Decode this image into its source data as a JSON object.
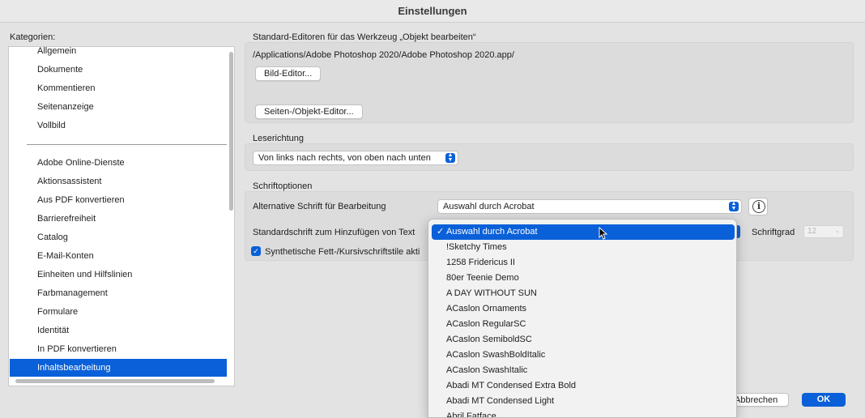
{
  "window": {
    "title": "Einstellungen"
  },
  "categories": {
    "label": "Kategorien:",
    "group1": [
      "Allgemein",
      "Dokumente",
      "Kommentieren",
      "Seitenanzeige",
      "Vollbild"
    ],
    "group2": [
      "Adobe Online-Dienste",
      "Aktionsassistent",
      "Aus PDF konvertieren",
      "Barrierefreiheit",
      "Catalog",
      "E-Mail-Konten",
      "Einheiten und Hilfslinien",
      "Farbmanagement",
      "Formulare",
      "Identität",
      "In PDF konvertieren",
      "Inhaltsbearbeitung"
    ],
    "selected": "Inhaltsbearbeitung"
  },
  "editors": {
    "label": "Standard-Editoren für das Werkzeug „Objekt bearbeiten“",
    "path": "/Applications/Adobe Photoshop 2020/Adobe Photoshop 2020.app/",
    "image_editor_button": "Bild-Editor...",
    "page_editor_button": "Seiten-/Objekt-Editor..."
  },
  "reading": {
    "label": "Leserichtung",
    "value": "Von links nach rechts, von oben nach unten"
  },
  "fonts": {
    "label": "Schriftoptionen",
    "alt_font_label": "Alternative Schrift für Bearbeitung",
    "alt_font_value": "Auswahl durch Acrobat",
    "default_font_label": "Standardschrift zum Hinzufügen von Text",
    "size_label": "Schriftgrad",
    "size_value": "12",
    "synthetic_label": "Synthetische Fett-/Kursivschriftstile akti"
  },
  "menu": {
    "items": [
      "Auswahl durch Acrobat",
      "!Sketchy Times",
      "1258 Fridericus II",
      "80er Teenie Demo",
      "A DAY WITHOUT SUN",
      "ACaslon Ornaments",
      "ACaslon RegularSC",
      "ACaslon SemiboldSC",
      "ACaslon SwashBoldItalic",
      "ACaslon SwashItalic",
      "Abadi MT Condensed Extra Bold",
      "Abadi MT Condensed Light",
      "Abril Fatface"
    ],
    "selected_index": 0,
    "check": "✓"
  },
  "footer": {
    "cancel_label": "Abbrechen",
    "ok_label": "OK"
  },
  "colors": {
    "accent": "#0a60d8"
  }
}
